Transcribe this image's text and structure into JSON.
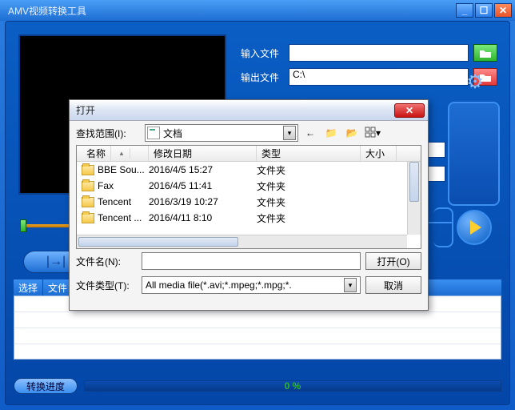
{
  "app": {
    "title": "AMV视频转换工具"
  },
  "titlebar": {
    "min": "_",
    "max": "☐",
    "close": "✕"
  },
  "fields": {
    "input_label": "输入文件",
    "output_label": "输出文件",
    "output_value": "C:\\"
  },
  "selbar": {
    "c1": "选择",
    "c2": "文件"
  },
  "progress": {
    "label": "转换进度",
    "pct": "0 %"
  },
  "dialog": {
    "title": "打开",
    "lookin_label": "查找范围(I):",
    "lookin_value": "文档",
    "cols": {
      "name": "名称",
      "date": "修改日期",
      "type": "类型",
      "size": "大小"
    },
    "rows": [
      {
        "name": "BBE Sou...",
        "date": "2016/4/5 15:27",
        "type": "文件夹"
      },
      {
        "name": "Fax",
        "date": "2016/4/5 11:41",
        "type": "文件夹"
      },
      {
        "name": "Tencent",
        "date": "2016/3/19 10:27",
        "type": "文件夹"
      },
      {
        "name": "Tencent ...",
        "date": "2016/4/11 8:10",
        "type": "文件夹"
      }
    ],
    "filename_label": "文件名(N):",
    "filetype_label": "文件类型(T):",
    "filetype_value": "All media file(*.avi;*.mpeg;*.mpg;*.",
    "open_btn": "打开(O)",
    "cancel_btn": "取消"
  }
}
